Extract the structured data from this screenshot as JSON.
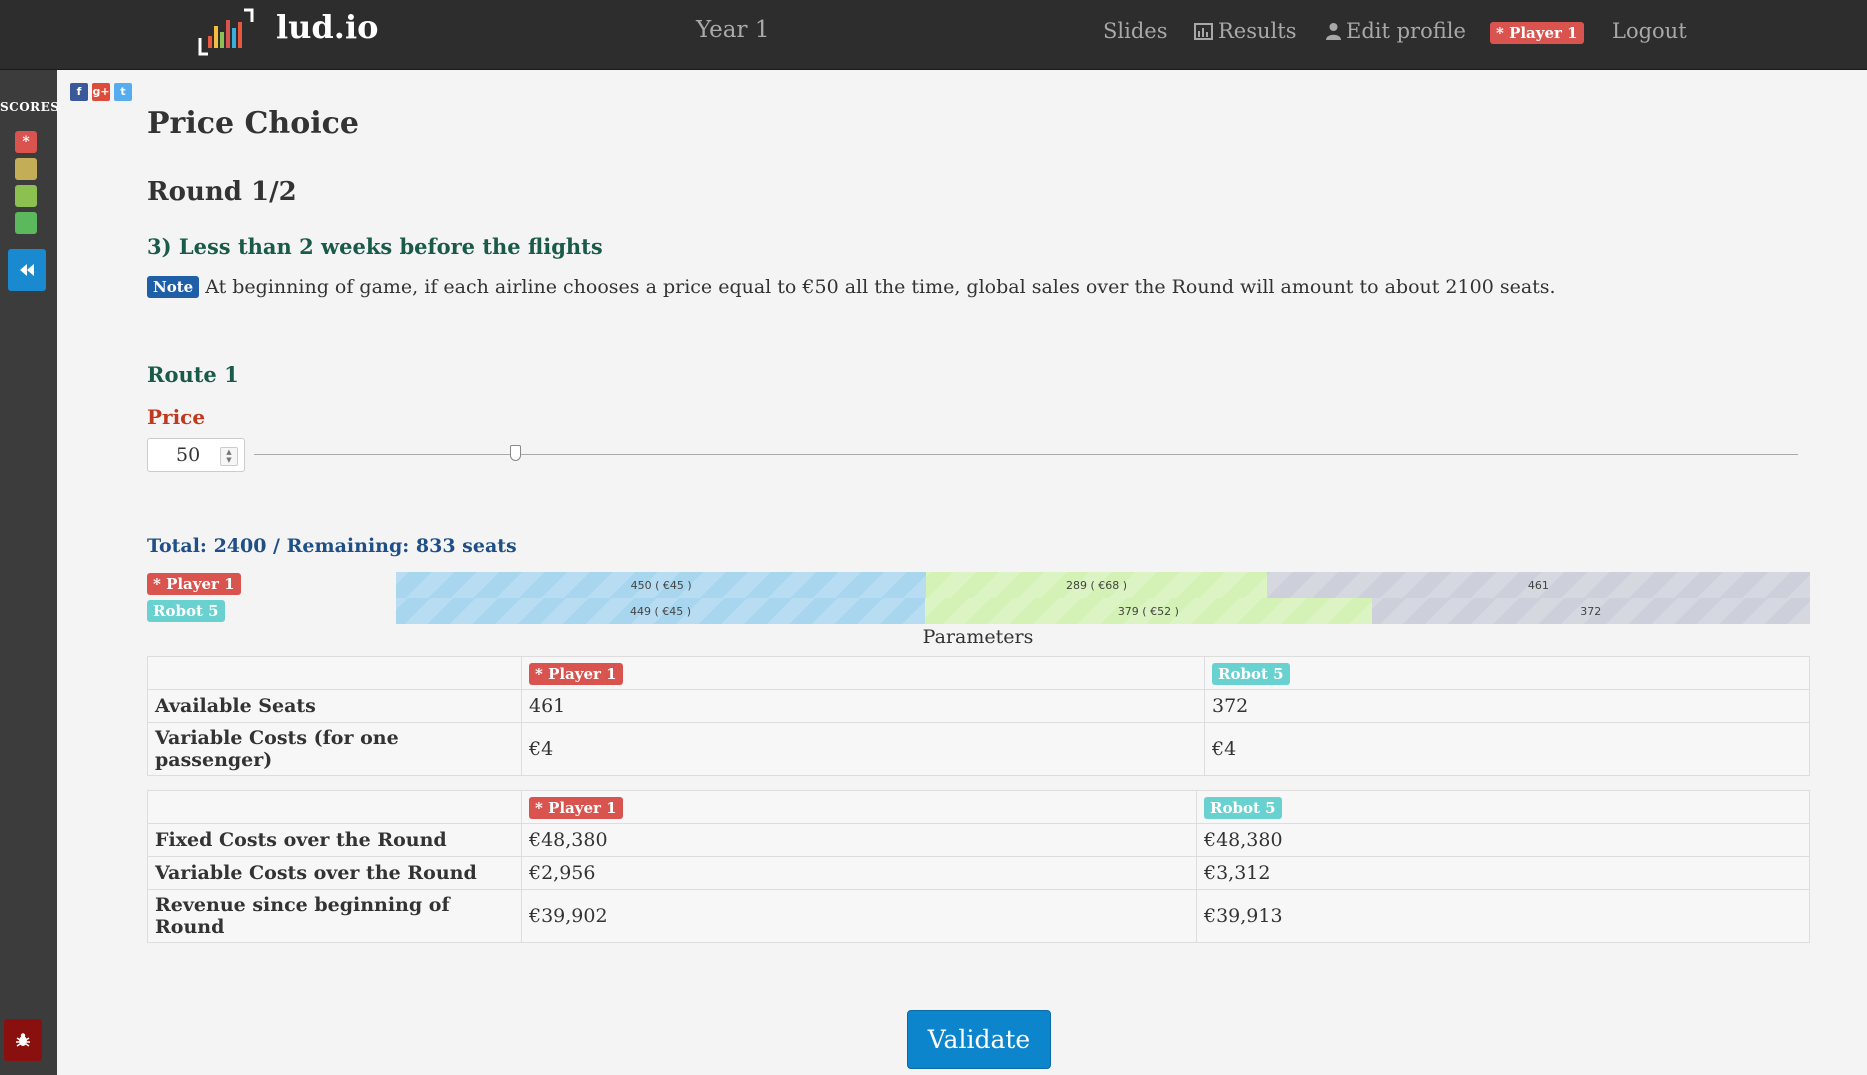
{
  "nav": {
    "brand": "lud.io",
    "year": "Year 1",
    "slides": "Slides",
    "results": "Results",
    "edit_profile": "Edit profile",
    "player_badge": "* Player 1",
    "logout": "Logout"
  },
  "sidebar": {
    "scores_title": "SCORES",
    "scores": [
      {
        "label": "*",
        "color": "#d9534f"
      },
      {
        "label": "",
        "color": "#c3ad56"
      },
      {
        "label": "",
        "color": "#8cc152"
      },
      {
        "label": "",
        "color": "#5cb85c"
      }
    ]
  },
  "page": {
    "title": "Price Choice",
    "round": "Round 1/2",
    "phase": "3) Less than 2 weeks before the flights",
    "note_badge": "Note",
    "note_text": "At beginning of game, if each airline chooses a price equal to €50 all the time, global sales over the Round will amount to about 2100 seats."
  },
  "route": {
    "title": "Route 1",
    "price_label": "Price",
    "price_value": "50",
    "slider_fraction": 0.169,
    "total_text": "Total: 2400 / Remaining: 833 seats"
  },
  "bars": [
    {
      "player": "* Player 1",
      "segments": [
        {
          "label": "450 ( €45 )",
          "value": 450,
          "color": "blue"
        },
        {
          "label": "289 ( €68 )",
          "value": 289,
          "color": "green"
        },
        {
          "label": "461",
          "value": 461,
          "color": "gray"
        }
      ]
    },
    {
      "player": "Robot 5",
      "segments": [
        {
          "label": "449 ( €45 )",
          "value": 449,
          "color": "blue"
        },
        {
          "label": "379 ( €52 )",
          "value": 379,
          "color": "green"
        },
        {
          "label": "372",
          "value": 372,
          "color": "gray"
        }
      ]
    }
  ],
  "params": {
    "title": "Parameters",
    "col1": "* Player 1",
    "col2": "Robot 5",
    "rows": [
      {
        "label": "Available Seats",
        "p1": "461",
        "p2": "372"
      },
      {
        "label": "Variable Costs (for one passenger)",
        "p1": "€4",
        "p2": "€4"
      }
    ]
  },
  "costs": {
    "col1": "* Player 1",
    "col2": "Robot 5",
    "rows": [
      {
        "label": "Fixed Costs over the Round",
        "p1": "€48,380",
        "p2": "€48,380"
      },
      {
        "label": "Variable Costs over the Round",
        "p1": "€2,956",
        "p2": "€3,312"
      },
      {
        "label": "Revenue since beginning of Round",
        "p1": "€39,902",
        "p2": "€39,913"
      }
    ]
  },
  "validate_label": "Validate"
}
